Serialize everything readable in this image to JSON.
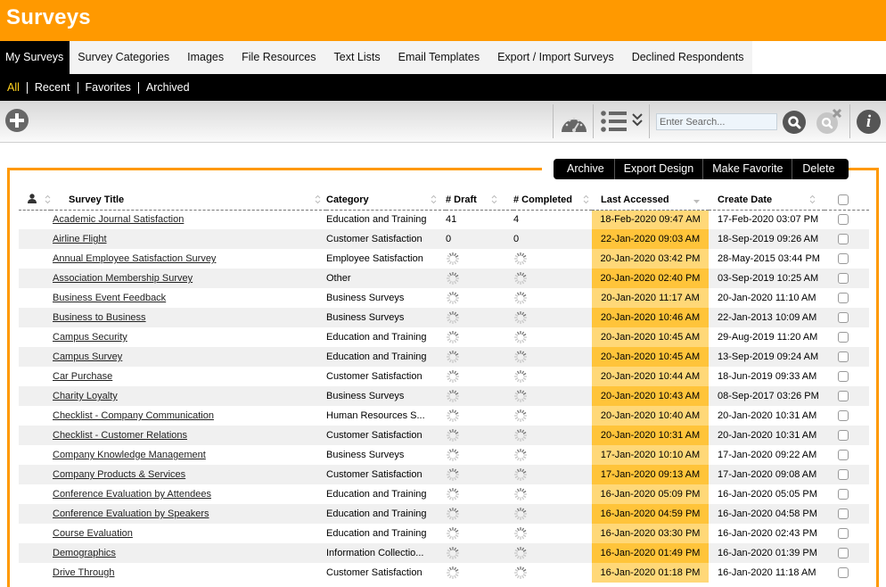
{
  "app": {
    "title": "Surveys"
  },
  "tabs": [
    {
      "label": "My Surveys",
      "active": true
    },
    {
      "label": "Survey Categories"
    },
    {
      "label": "Images"
    },
    {
      "label": "File Resources"
    },
    {
      "label": "Text Lists"
    },
    {
      "label": "Email Templates"
    },
    {
      "label": "Export / Import Surveys"
    },
    {
      "label": "Declined Respondents"
    }
  ],
  "filters": [
    {
      "label": "All",
      "active": true
    },
    {
      "label": "Recent"
    },
    {
      "label": "Favorites"
    },
    {
      "label": "Archived"
    }
  ],
  "toolbar": {
    "add_icon": "plus-circle-icon",
    "dashboard_icon": "gauge-icon",
    "view_icon": "list-icon",
    "search_placeholder": "Enter Search...",
    "search_value": "",
    "search_icon": "magnifier-icon",
    "clear_search_icon": "clear-search-icon",
    "info_icon": "info-icon",
    "info_glyph": "i"
  },
  "actions": [
    "Archive",
    "Export Design",
    "Make Favorite",
    "Delete"
  ],
  "colors": {
    "brand": "#ff9900",
    "active_filter": "#ffd21f",
    "last_accessed_light": "#ffd878",
    "last_accessed_dark": "#ffc43a"
  },
  "table": {
    "columns": {
      "owner_icon": "user-icon",
      "title": "Survey Title",
      "category": "Category",
      "draft": "# Draft",
      "completed": "# Completed",
      "last_accessed": "Last Accessed",
      "create_date": "Create Date"
    },
    "sorted_by": "Last Accessed",
    "sort_direction": "descending",
    "rows": [
      {
        "title": "Academic Journal Satisfaction",
        "category": "Education and Training",
        "draft": "41",
        "completed": "4",
        "last_accessed": "18-Feb-2020 09:47 AM",
        "create_date": "17-Feb-2020 03:07 PM"
      },
      {
        "title": "Airline Flight",
        "category": "Customer Satisfaction",
        "draft": "0",
        "completed": "0",
        "last_accessed": "22-Jan-2020 09:03 AM",
        "create_date": "18-Sep-2019 09:26 AM"
      },
      {
        "title": "Annual Employee Satisfaction Survey",
        "category": "Employee Satisfaction",
        "draft": null,
        "completed": null,
        "last_accessed": "20-Jan-2020 03:42 PM",
        "create_date": "28-May-2015 03:44 PM"
      },
      {
        "title": "Association Membership Survey",
        "category": "Other",
        "draft": null,
        "completed": null,
        "last_accessed": "20-Jan-2020 02:40 PM",
        "create_date": "03-Sep-2019 10:25 AM"
      },
      {
        "title": "Business Event Feedback",
        "category": "Business Surveys",
        "draft": null,
        "completed": null,
        "last_accessed": "20-Jan-2020 11:17 AM",
        "create_date": "20-Jan-2020 11:10 AM"
      },
      {
        "title": "Business to Business",
        "category": "Business Surveys",
        "draft": null,
        "completed": null,
        "last_accessed": "20-Jan-2020 10:46 AM",
        "create_date": "22-Jan-2013 10:09 AM"
      },
      {
        "title": "Campus Security",
        "category": "Education and Training",
        "draft": null,
        "completed": null,
        "last_accessed": "20-Jan-2020 10:45 AM",
        "create_date": "29-Aug-2019 11:20 AM"
      },
      {
        "title": "Campus Survey",
        "category": "Education and Training",
        "draft": null,
        "completed": null,
        "last_accessed": "20-Jan-2020 10:45 AM",
        "create_date": "13-Sep-2019 09:24 AM"
      },
      {
        "title": "Car Purchase",
        "category": "Customer Satisfaction",
        "draft": null,
        "completed": null,
        "last_accessed": "20-Jan-2020 10:44 AM",
        "create_date": "18-Jun-2019 09:33 AM"
      },
      {
        "title": "Charity Loyalty",
        "category": "Business Surveys",
        "draft": null,
        "completed": null,
        "last_accessed": "20-Jan-2020 10:43 AM",
        "create_date": "08-Sep-2017 03:26 PM"
      },
      {
        "title": "Checklist - Company Communication",
        "category": "Human Resources S...",
        "draft": null,
        "completed": null,
        "last_accessed": "20-Jan-2020 10:40 AM",
        "create_date": "20-Jan-2020 10:31 AM"
      },
      {
        "title": "Checklist - Customer Relations",
        "category": "Customer Satisfaction",
        "draft": null,
        "completed": null,
        "last_accessed": "20-Jan-2020 10:31 AM",
        "create_date": "20-Jan-2020 10:31 AM"
      },
      {
        "title": "Company Knowledge Management",
        "category": "Business Surveys",
        "draft": null,
        "completed": null,
        "last_accessed": "17-Jan-2020 10:10 AM",
        "create_date": "17-Jan-2020 09:22 AM"
      },
      {
        "title": "Company Products & Services",
        "category": "Customer Satisfaction",
        "draft": null,
        "completed": null,
        "last_accessed": "17-Jan-2020 09:13 AM",
        "create_date": "17-Jan-2020 09:08 AM"
      },
      {
        "title": "Conference Evaluation by Attendees",
        "category": "Education and Training",
        "draft": null,
        "completed": null,
        "last_accessed": "16-Jan-2020 05:09 PM",
        "create_date": "16-Jan-2020 05:05 PM"
      },
      {
        "title": "Conference Evaluation by Speakers",
        "category": "Education and Training",
        "draft": null,
        "completed": null,
        "last_accessed": "16-Jan-2020 04:59 PM",
        "create_date": "16-Jan-2020 04:58 PM"
      },
      {
        "title": "Course Evaluation",
        "category": "Education and Training",
        "draft": null,
        "completed": null,
        "last_accessed": "16-Jan-2020 03:30 PM",
        "create_date": "16-Jan-2020 02:43 PM"
      },
      {
        "title": "Demographics",
        "category": "Information Collectio...",
        "draft": null,
        "completed": null,
        "last_accessed": "16-Jan-2020 01:49 PM",
        "create_date": "16-Jan-2020 01:39 PM"
      },
      {
        "title": "Drive Through",
        "category": "Customer Satisfaction",
        "draft": null,
        "completed": null,
        "last_accessed": "16-Jan-2020 01:18 PM",
        "create_date": "16-Jan-2020 11:18 AM"
      }
    ]
  }
}
